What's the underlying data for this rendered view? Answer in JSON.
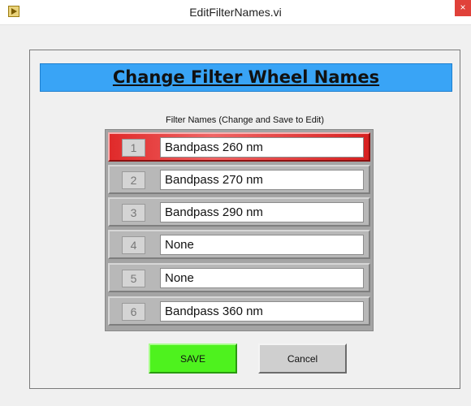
{
  "window": {
    "title": "EditFilterNames.vi",
    "close_label": "×"
  },
  "banner": {
    "title": "Change Filter Wheel Names",
    "color": "#39a4f6"
  },
  "filter_list": {
    "label": "Filter Names (Change and Save to Edit)",
    "selected_index": 1,
    "rows": [
      {
        "index": "1",
        "name": "Bandpass 260 nm"
      },
      {
        "index": "2",
        "name": "Bandpass 270 nm"
      },
      {
        "index": "3",
        "name": "Bandpass 290 nm"
      },
      {
        "index": "4",
        "name": "None"
      },
      {
        "index": "5",
        "name": "None"
      },
      {
        "index": "6",
        "name": "Bandpass 360 nm"
      }
    ]
  },
  "buttons": {
    "save_label": "SAVE",
    "save_color": "#4ef21e",
    "cancel_label": "Cancel"
  }
}
